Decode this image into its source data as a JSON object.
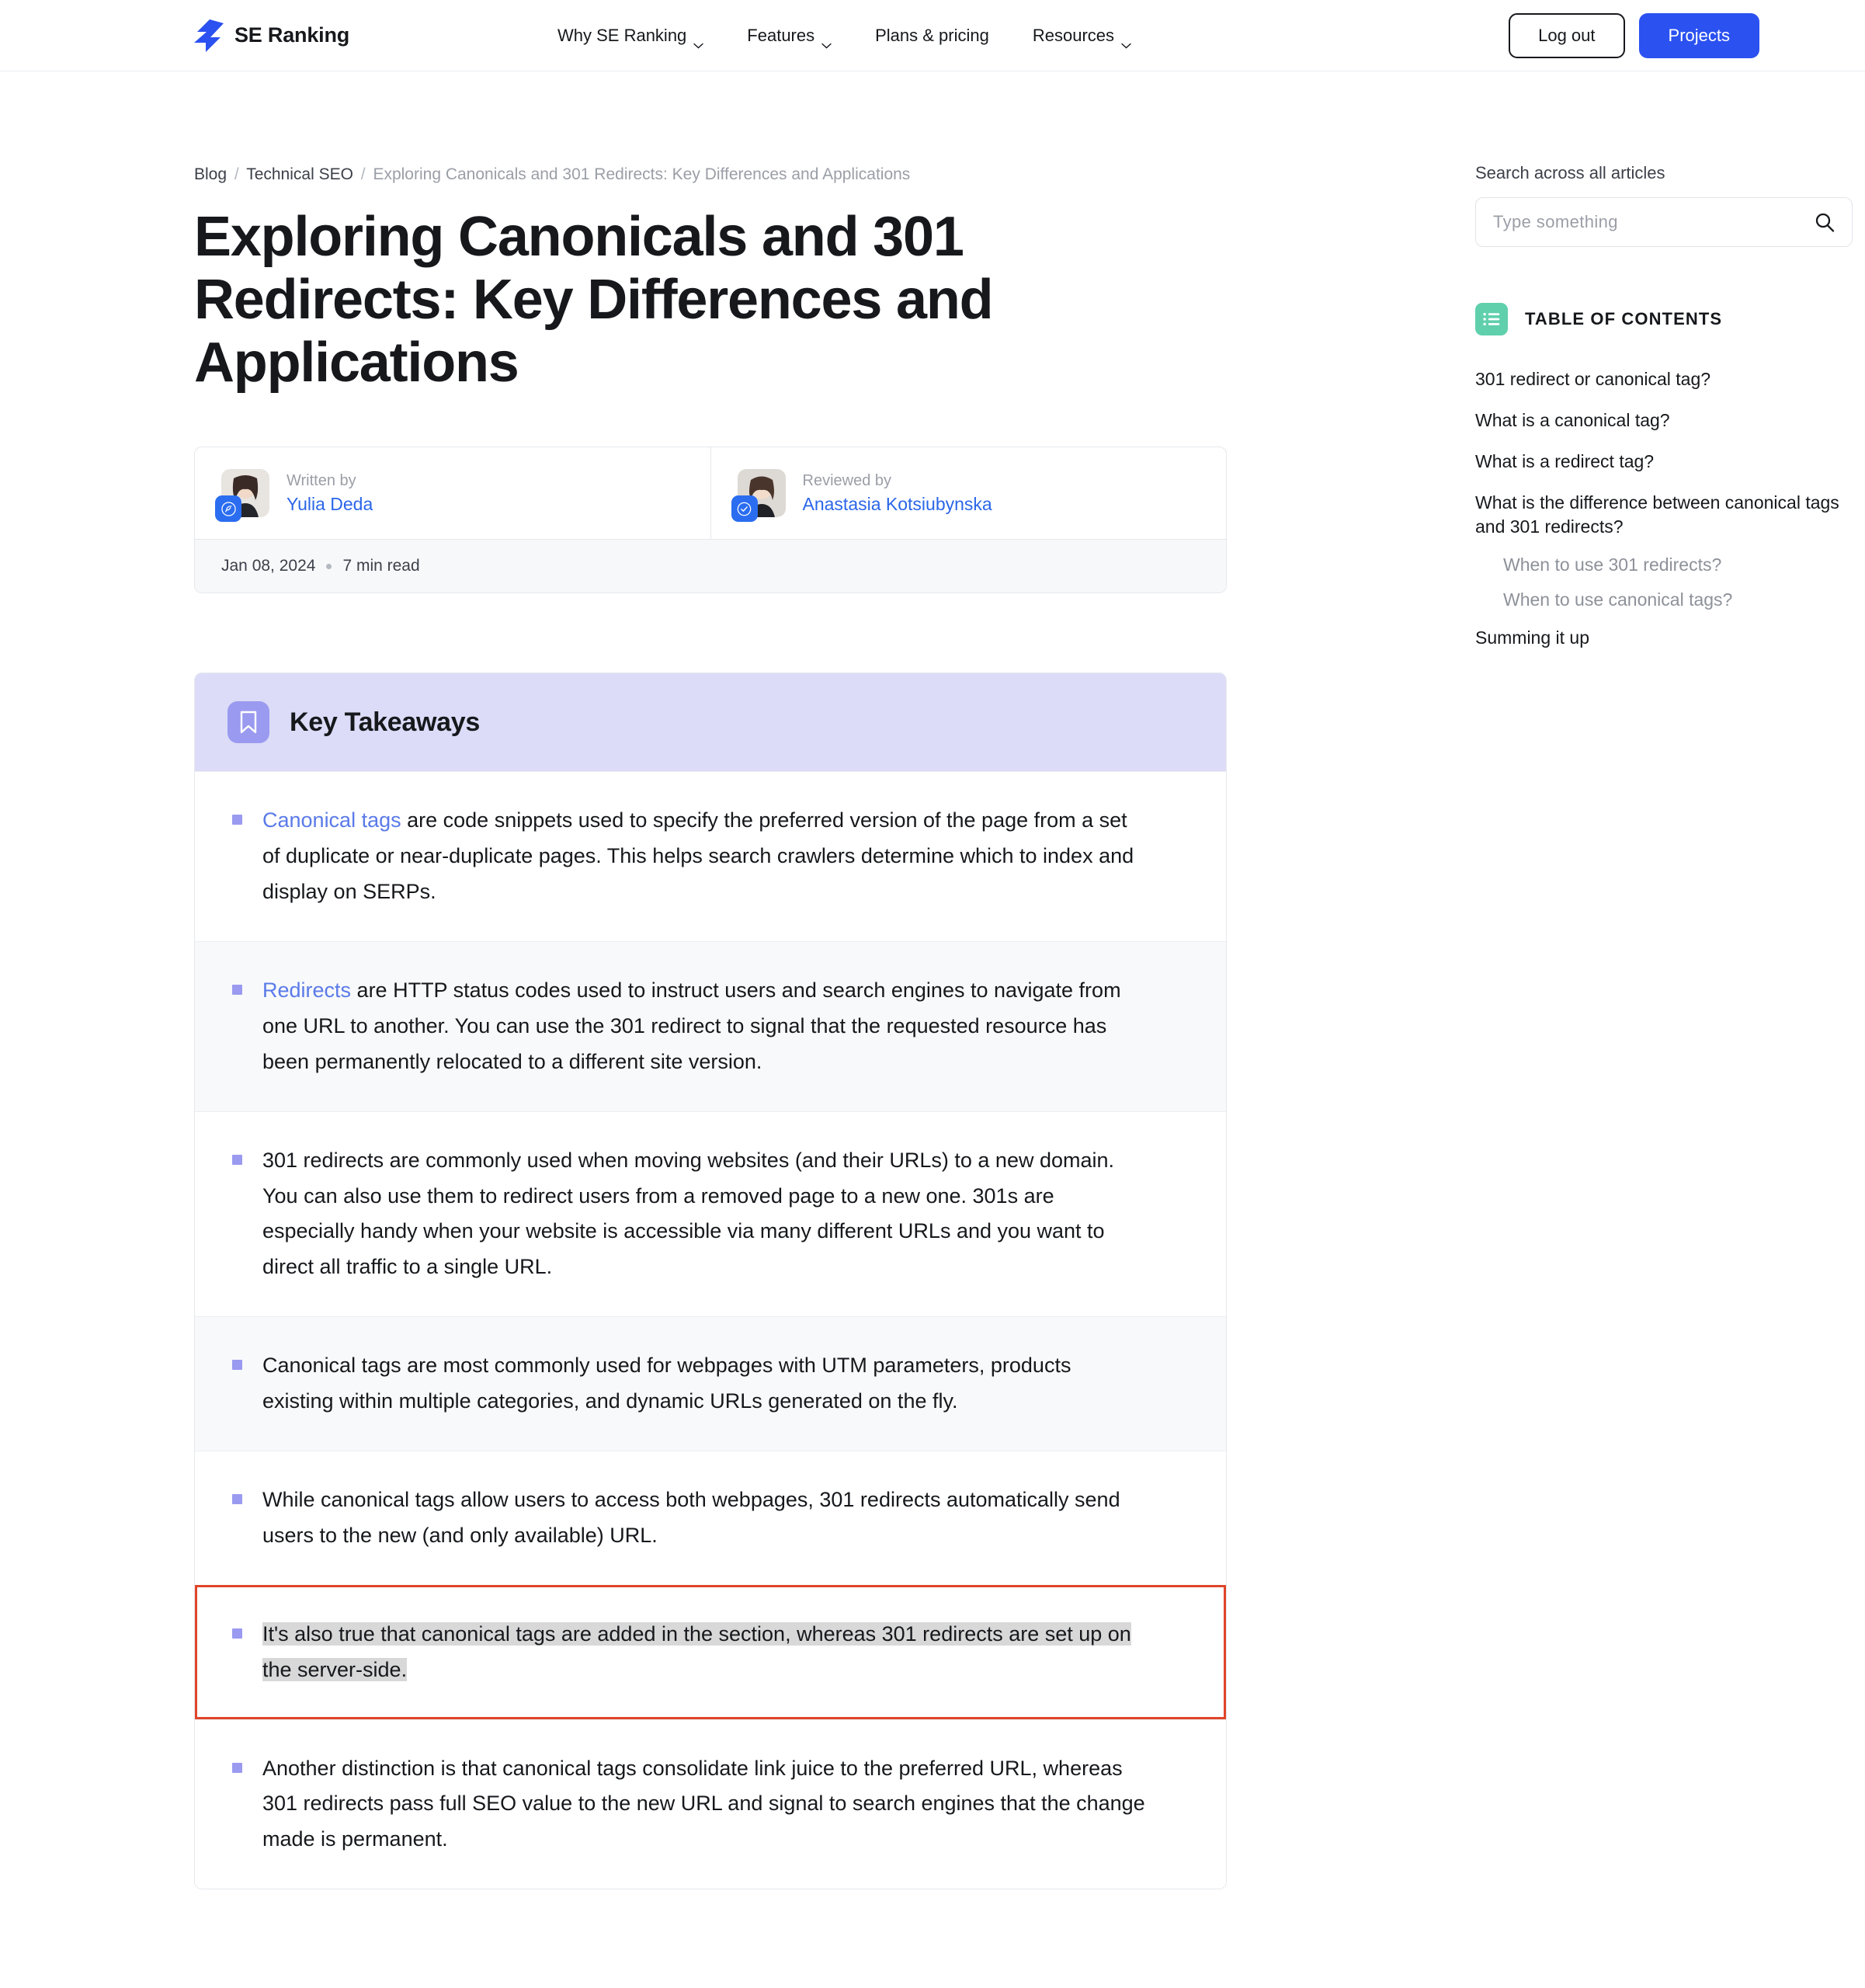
{
  "header": {
    "brand": "SE Ranking",
    "nav": [
      {
        "label": "Why SE Ranking",
        "has_chevron": true
      },
      {
        "label": "Features",
        "has_chevron": true
      },
      {
        "label": "Plans & pricing",
        "has_chevron": false
      },
      {
        "label": "Resources",
        "has_chevron": true
      }
    ],
    "logout_label": "Log out",
    "projects_label": "Projects"
  },
  "breadcrumb": {
    "blog": "Blog",
    "category": "Technical SEO",
    "current": "Exploring Canonicals and 301 Redirects: Key Differences and Applications",
    "separator": "/"
  },
  "article": {
    "title": "Exploring Canonicals and 301 Redirects: Key Differences and Applications",
    "written_by_label": "Written by",
    "author_name": "Yulia Deda",
    "reviewed_by_label": "Reviewed by",
    "reviewer_name": "Anastasia Kotsiubynska",
    "date": "Jan 08, 2024",
    "read_time": "7 min read"
  },
  "takeaways": {
    "heading": "Key Takeaways",
    "icon": "bookmark-icon",
    "items": [
      {
        "link_text": "Canonical tags",
        "rest": " are code snippets used to specify the preferred version of the page from a set of duplicate or near-duplicate pages. This helps search crawlers determine which to index and display on SERPs."
      },
      {
        "link_text": "Redirects",
        "rest": " are HTTP status codes used to instruct users and search engines to navigate from one URL to another. You can use the 301 redirect to signal that the requested resource has been permanently relocated to a different site version."
      },
      {
        "link_text": "",
        "rest": "301 redirects are commonly used when moving websites (and their URLs) to a new domain. You can also use them to redirect users from a removed page to a new one. 301s are especially handy when your website is accessible via many different URLs and you want to direct all traffic to a single URL."
      },
      {
        "link_text": "",
        "rest": "Canonical tags are most commonly used for webpages with UTM parameters, products existing within multiple categories, and dynamic URLs generated on the fly."
      },
      {
        "link_text": "",
        "rest": "While canonical tags allow users to access both webpages, 301 redirects automatically send users to the new (and only available) URL."
      },
      {
        "link_text": "",
        "rest": "It's also true that canonical tags are added in the section, whereas 301 redirects are set up on the server-side.",
        "annotated": true,
        "selected": true
      },
      {
        "link_text": "",
        "rest": "Another distinction is that canonical tags consolidate link juice to the preferred URL, whereas 301 redirects pass full SEO value to the new URL and signal to search engines that the change made is permanent."
      }
    ]
  },
  "sidebar": {
    "search_label": "Search across all articles",
    "search_value": "",
    "search_placeholder": "Type something",
    "search_icon": "search-icon",
    "toc_icon": "list-icon",
    "toc_title": "TABLE OF CONTENTS",
    "toc_items": [
      {
        "label": "301 redirect or canonical tag?",
        "sub": false
      },
      {
        "label": "What is a canonical tag?",
        "sub": false
      },
      {
        "label": "What is a redirect tag?",
        "sub": false
      },
      {
        "label": "What is the difference between canonical tags and 301 redirects?",
        "sub": false
      },
      {
        "label": "When to use 301 redirects?",
        "sub": true
      },
      {
        "label": "When to use canonical tags?",
        "sub": true
      },
      {
        "label": "Summing it up",
        "sub": false
      }
    ]
  },
  "colors": {
    "brand_blue": "#2b51f0",
    "link_blue": "#2b66e8",
    "takeaway_header": "#dcdcf8",
    "takeaway_accent": "#9a9af0",
    "toc_icon_green": "#5fd0ab",
    "annotation_red": "#e0452a",
    "selection_gray": "#d8d8d8"
  }
}
